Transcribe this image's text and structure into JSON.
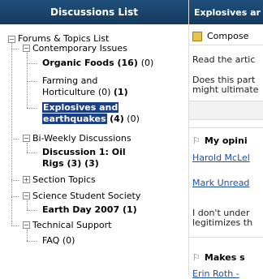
{
  "left_panel": {
    "title": "Discussions List",
    "tree": {
      "root_label": "Forums & Topics List",
      "groups": [
        {
          "label": "Contemporary Issues",
          "items": [
            {
              "name": "Organic Foods",
              "counts": "(16)",
              "new": "(0)",
              "bold": true
            },
            {
              "name1": "Farming and",
              "name2": "Horticulture",
              "counts": "(0)",
              "new": "(1)"
            },
            {
              "name1": "Explosives and",
              "name2": "earthquakes",
              "counts": "(4)",
              "new": "(0)",
              "selected": true
            }
          ]
        },
        {
          "label": "Bi-Weekly Discussions",
          "items": [
            {
              "name1": "Discussion 1: Oil",
              "name2": "Rigs",
              "counts": "(3)",
              "new": "(3)",
              "bold": true
            }
          ]
        },
        {
          "label": "Section Topics"
        },
        {
          "label": "Science Student Society",
          "items": [
            {
              "name": "Earth Day 2007",
              "counts": "(1)",
              "bold": true
            }
          ]
        },
        {
          "label": "Technical Support",
          "items": [
            {
              "name": "FAQ",
              "counts": "(0)"
            }
          ]
        }
      ]
    }
  },
  "right_panel": {
    "title": "Explosives ar",
    "compose_label": "Compose",
    "text1": "Read the artic",
    "text2a": "Does this part",
    "text2b": "might ultimate",
    "post1": {
      "title": "My opini",
      "author1": "Harold McLel",
      "author2": "Mark Unread",
      "body1": "I don't under",
      "body2": "legitimizes th"
    },
    "post2": {
      "title": "Makes s",
      "author": "Erin Roth -"
    }
  }
}
